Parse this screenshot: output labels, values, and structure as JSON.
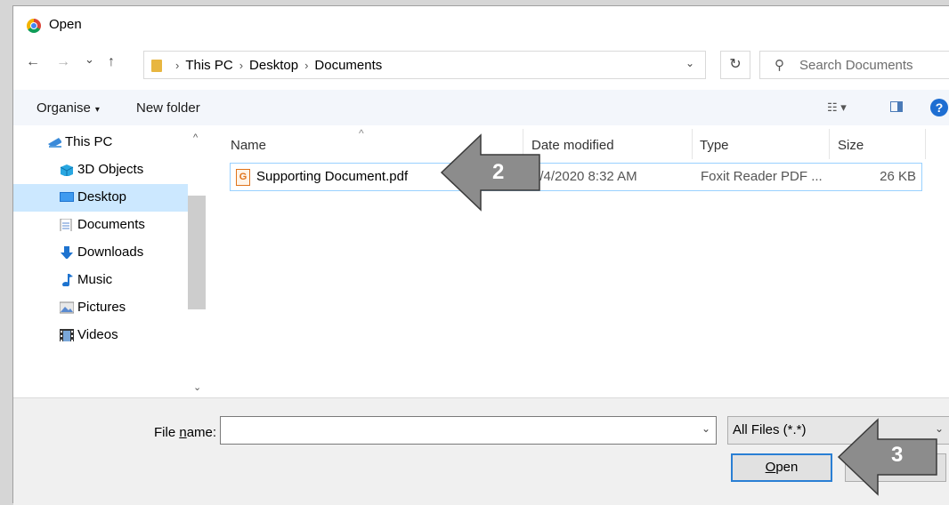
{
  "window": {
    "title": "Open",
    "close_glyph": "✕"
  },
  "address": {
    "back": "←",
    "forward": "→",
    "history": "⌄",
    "up": "↑",
    "crumbs": [
      "This PC",
      "Desktop",
      "Documents"
    ],
    "sep": "›",
    "dropdown": "⌄",
    "refresh": "↻",
    "search_placeholder": "Search Documents"
  },
  "toolbar": {
    "organise": "Organise",
    "organise_caret": "▾",
    "new_folder": "New folder",
    "help": "?"
  },
  "nav": {
    "items": [
      {
        "label": "This PC",
        "icon": "computer-icon"
      },
      {
        "label": "3D Objects",
        "icon": "cube-icon"
      },
      {
        "label": "Desktop",
        "icon": "desktop-icon",
        "selected": true
      },
      {
        "label": "Documents",
        "icon": "document-icon"
      },
      {
        "label": "Downloads",
        "icon": "download-icon"
      },
      {
        "label": "Music",
        "icon": "music-icon"
      },
      {
        "label": "Pictures",
        "icon": "pictures-icon"
      },
      {
        "label": "Videos",
        "icon": "video-icon"
      }
    ]
  },
  "columns": {
    "name": "Name",
    "date": "Date modified",
    "type": "Type",
    "size": "Size"
  },
  "files": [
    {
      "name": "Supporting Document.pdf",
      "date": "3/4/2020 8:32 AM",
      "type": "Foxit Reader PDF ...",
      "size": "26 KB"
    }
  ],
  "bottom": {
    "file_name_label_pre": "File ",
    "file_name_label_u": "n",
    "file_name_label_post": "ame:",
    "file_name_value": "",
    "file_type": "All Files (*.*)",
    "open_u": "O",
    "open_rest": "pen",
    "cancel_label": ""
  },
  "callouts": {
    "step2": "2",
    "step3": "3"
  },
  "colors": {
    "selection": "#cce8ff",
    "accent": "#2a7fd4",
    "callout": "#8c8c8c"
  }
}
